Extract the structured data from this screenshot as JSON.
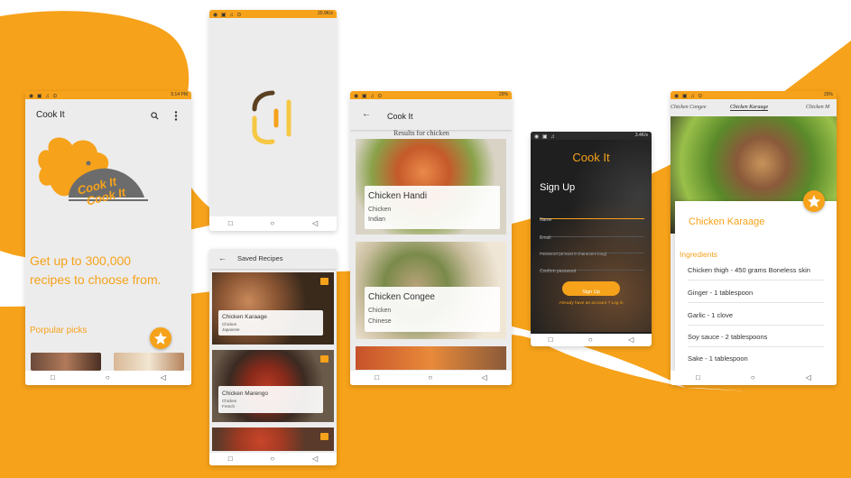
{
  "colors": {
    "accent": "#f6a21a",
    "background": "#ffffff",
    "dark": "#1f1f1f"
  },
  "statusbar": {
    "s1": "1.60K/s",
    "s1b": "5:14 PM",
    "s2": "20.9K/s",
    "s3": "7.42K/s",
    "s3b": "29%",
    "s4": "3.4K/s",
    "s5": "10.4K/s",
    "s5b": "29%"
  },
  "screen1": {
    "app_title": "Cook It",
    "logo_text": "Cook It",
    "headline": "Get up to 300,000 recipes to choose from.",
    "section_title": "Porpular picks",
    "icons": {
      "search": "search-icon",
      "menu": "more-vert-icon",
      "fab": "star-icon"
    }
  },
  "screen2": {
    "splash_logo": "cook-it-splash-icon"
  },
  "screen3": {
    "title": "Saved Recipes",
    "items": [
      {
        "name": "Chicken Karaage",
        "category": "Chicken",
        "cuisine": "Japanese"
      },
      {
        "name": "Chicken Marengo",
        "category": "Chicken",
        "cuisine": "French"
      }
    ]
  },
  "screen4": {
    "title": "Cook It",
    "results_label": "Results for chicken",
    "items": [
      {
        "name": "Chicken Handi",
        "category": "Chicken",
        "cuisine": "Indian"
      },
      {
        "name": "Chicken Congee",
        "category": "Chicken",
        "cuisine": "Chinese"
      }
    ]
  },
  "screen5": {
    "app_title": "Cook It",
    "heading": "Sign Up",
    "fields": {
      "name": "Name",
      "email": "Email",
      "password": "Password (at least 8 characters long)",
      "confirm": "Confirm password"
    },
    "button": "Sign Up",
    "login_link": "Already have an account ? Log in"
  },
  "screen6": {
    "tabs": [
      "Chicken Congee",
      "Chicken Karaage",
      "Chicken M"
    ],
    "recipe_title": "Chicken Karaage",
    "ingredients_title": "Ingredients",
    "ingredients": [
      "Chicken thigh - 450 grams Boneless skin",
      "Ginger - 1 tablespoon",
      "Garlic - 1 clove",
      "Soy sauce - 2 tablespoons",
      "Sake - 1 tablespoon"
    ]
  }
}
